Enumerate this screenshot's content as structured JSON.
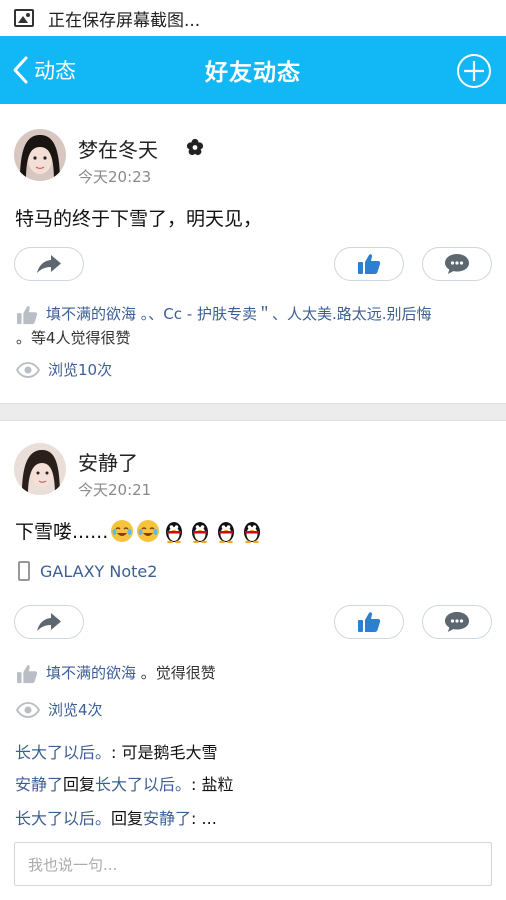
{
  "status_bar": {
    "text": "正在保存屏幕截图..."
  },
  "nav": {
    "back_label": "动态",
    "title": "好友动态",
    "accent": "#12b7f5"
  },
  "posts": [
    {
      "user": "梦在冬天",
      "time": "今天20:23",
      "text": "特马的终于下雪了，明天见，",
      "likes_names": "填不满的欲海",
      "likes_rest": " 。、Cc - 护肤专卖＂、人太美.路太远.别后悔",
      "likes_suffix": "。等4人觉得很赞",
      "views": "浏览10次"
    },
    {
      "user": "安静了",
      "time": "今天20:21",
      "text": "下雪喽......",
      "emojis": [
        "tear-joy-emoji",
        "tear-joy-emoji",
        "penguin-emoji",
        "penguin-emoji",
        "penguin-emoji",
        "penguin-emoji"
      ],
      "device": "GALAXY Note2",
      "likes_names": "填不满的欲海",
      "likes_suffix": " 。觉得很赞",
      "views": "浏览4次",
      "comments": [
        {
          "author": "长大了以后。",
          "sep": ": ",
          "text": "可是鹅毛大雪"
        },
        {
          "author": "安静了",
          "mid": "回复",
          "target": "长大了以后。",
          "sep": ": ",
          "text": "盐粒"
        },
        {
          "author": "长大了以后。",
          "mid": "回复",
          "target": "安静了",
          "sep": ": ",
          "text": "..."
        }
      ],
      "reply_placeholder": "我也说一句..."
    }
  ]
}
